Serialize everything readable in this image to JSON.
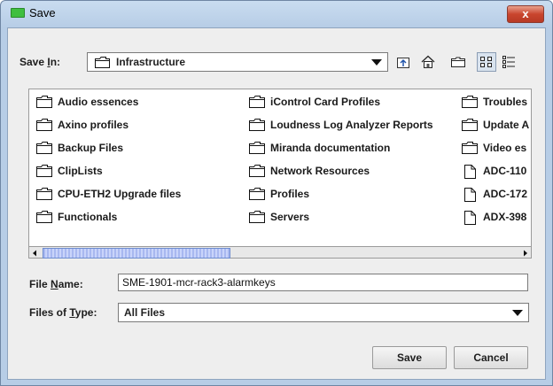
{
  "window": {
    "title": "Save",
    "close_glyph": "x"
  },
  "save_in": {
    "label_pre": "Save ",
    "label_mnemonic": "I",
    "label_post": "n:",
    "value": "Infrastructure"
  },
  "toolbar": {
    "icons": [
      "up-one-level-icon",
      "home-icon",
      "new-folder-icon",
      "list-view-icon",
      "details-view-icon"
    ],
    "selected": "list-view-icon"
  },
  "files": {
    "columns": [
      [
        {
          "name": "Audio essences",
          "type": "folder"
        },
        {
          "name": "Axino profiles",
          "type": "folder"
        },
        {
          "name": "Backup Files",
          "type": "folder"
        },
        {
          "name": "ClipLists",
          "type": "folder"
        },
        {
          "name": "CPU-ETH2 Upgrade files",
          "type": "folder"
        },
        {
          "name": "Functionals",
          "type": "folder"
        }
      ],
      [
        {
          "name": "iControl Card Profiles",
          "type": "folder"
        },
        {
          "name": "Loudness Log Analyzer Reports",
          "type": "folder"
        },
        {
          "name": "Miranda documentation",
          "type": "folder"
        },
        {
          "name": "Network Resources",
          "type": "folder"
        },
        {
          "name": "Profiles",
          "type": "folder"
        },
        {
          "name": "Servers",
          "type": "folder"
        }
      ],
      [
        {
          "name": "Troubles",
          "type": "folder"
        },
        {
          "name": "Update A",
          "type": "folder"
        },
        {
          "name": "Video es",
          "type": "folder"
        },
        {
          "name": "ADC-110",
          "type": "file"
        },
        {
          "name": "ADC-172",
          "type": "file"
        },
        {
          "name": "ADX-398",
          "type": "file"
        }
      ]
    ]
  },
  "file_name": {
    "label_pre": "File ",
    "label_mnemonic": "N",
    "label_post": "ame:",
    "value": "SME-1901-mcr-rack3-alarmkeys"
  },
  "file_type": {
    "label_pre": "Files of ",
    "label_mnemonic": "T",
    "label_post": "ype:",
    "value": "All Files"
  },
  "buttons": {
    "save": "Save",
    "cancel": "Cancel"
  },
  "colors": {
    "title_bg": "#c9dcf0",
    "client_bg": "#eeeeee",
    "close_red": "#c9452e",
    "scroll_thumb": "#a8b8f0"
  }
}
